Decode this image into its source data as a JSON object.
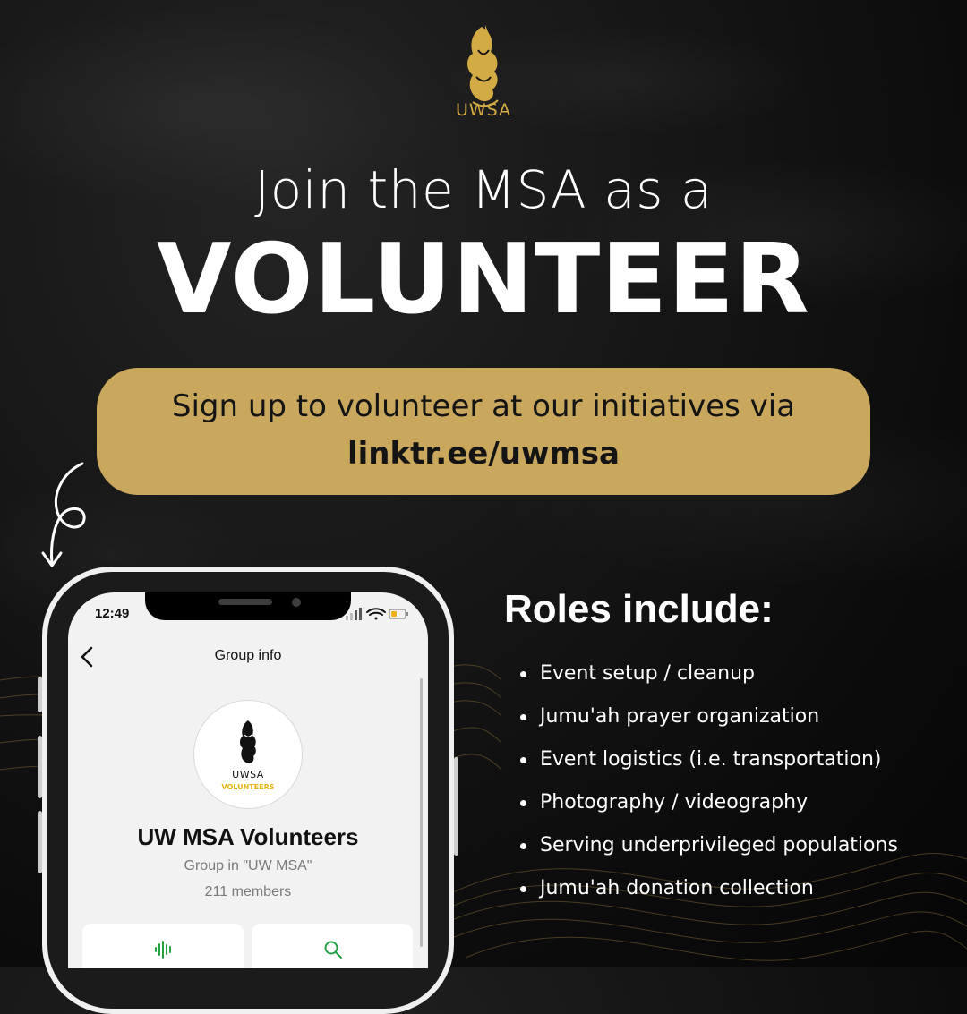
{
  "brand": {
    "logo_text": "UWSA"
  },
  "header": {
    "headline": "Join the MSA as a",
    "title": "VOLUNTEER"
  },
  "cta": {
    "line": "Sign up to volunteer at our initiatives via",
    "link": "linktr.ee/uwmsa"
  },
  "phone": {
    "status_time": "12:49",
    "screen_title": "Group info",
    "avatar_brand": "UWSA",
    "avatar_sub": "VOLUNTEERS",
    "group_name": "UW MSA Volunteers",
    "group_sub": "Group in \"UW MSA\"",
    "members": "211 members",
    "actions": [
      {
        "icon": "audio-waveform-icon"
      },
      {
        "icon": "search-icon"
      }
    ]
  },
  "roles": {
    "title": "Roles include:",
    "items": [
      "Event setup / cleanup",
      "Jumu'ah prayer organization",
      "Event logistics (i.e. transportation)",
      "Photography / videography",
      "Serving underprivileged populations",
      "Jumu'ah donation collection"
    ]
  },
  "colors": {
    "background": "#0b0b0b",
    "gold": "#d3ab45",
    "pill": "#c9a75c",
    "accent_green": "#25a244"
  }
}
